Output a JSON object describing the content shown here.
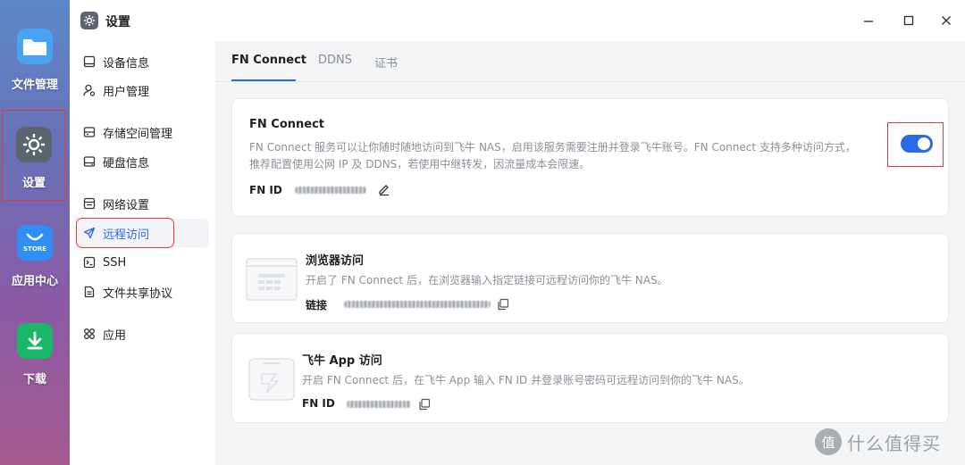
{
  "colors": {
    "accent": "#2a6ae6",
    "highlight": "#e53935"
  },
  "dock": {
    "items": [
      {
        "label": "文件管理",
        "icon": "folder-icon"
      },
      {
        "label": "设置",
        "icon": "gear-icon",
        "selected": true
      },
      {
        "label": "应用中心",
        "icon": "store-icon",
        "badge": "STORE"
      },
      {
        "label": "下载",
        "icon": "download-icon"
      }
    ]
  },
  "window": {
    "title": "设置",
    "controls": [
      "minimize-icon",
      "maximize-icon",
      "close-icon"
    ]
  },
  "sidebar": {
    "items": [
      {
        "label": "设备信息",
        "icon": "device-icon"
      },
      {
        "label": "用户管理",
        "icon": "user-icon"
      },
      {
        "label": "存储空间管理",
        "icon": "storage-icon"
      },
      {
        "label": "硬盘信息",
        "icon": "disk-icon"
      },
      {
        "label": "网络设置",
        "icon": "network-icon"
      },
      {
        "label": "远程访问",
        "icon": "send-icon",
        "active": true
      },
      {
        "label": "SSH",
        "icon": "terminal-icon"
      },
      {
        "label": "文件共享协议",
        "icon": "document-icon"
      },
      {
        "label": "应用",
        "icon": "apps-icon"
      }
    ]
  },
  "tabs": [
    {
      "label": "FN Connect",
      "active": true
    },
    {
      "label": "DDNS"
    },
    {
      "label": "证书"
    }
  ],
  "fn_connect": {
    "title": "FN Connect",
    "desc_line1": "FN Connect 服务可以让你随时随地访问到飞牛 NAS，启用该服务需要注册并登录飞牛账号。FN Connect 支持多种访问方式，",
    "desc_line2": "推荐配置使用公网 IP 及 DDNS，若使用中继转发，因流量成本会限速。",
    "id_label": "FN ID",
    "enabled": true
  },
  "browser_access": {
    "title": "浏览器访问",
    "desc": "开启了 FN Connect 后，在浏览器输入指定链接可远程访问你的飞牛 NAS。",
    "link_label": "链接"
  },
  "app_access": {
    "title": "飞牛 App 访问",
    "desc": "开启 FN Connect 后，在飞牛 App 输入 FN ID 并登录账号密码可远程访问到你的飞牛 NAS。",
    "id_label": "FN ID"
  },
  "watermark": {
    "symbol": "值",
    "text": "什么值得买"
  }
}
